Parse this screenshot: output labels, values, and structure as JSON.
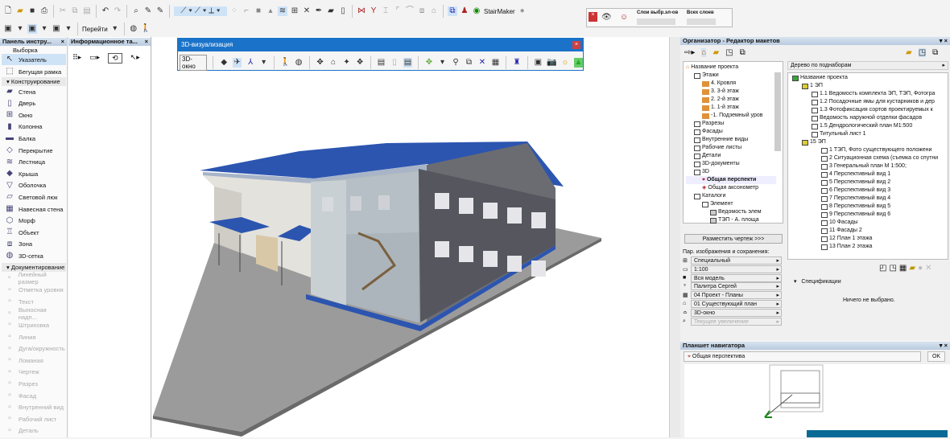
{
  "toolbar": {
    "goto_label": "Перейти",
    "stairmaker_label": "StairMaker",
    "layers_selected_label": "Слои выбр.эл-ов",
    "all_layers_label": "Всех слоев"
  },
  "toolbox": {
    "title": "Панель инстру...",
    "selection_label": "Выборка",
    "items_top": [
      {
        "label": "Указатель",
        "icon": "arrow-icon"
      },
      {
        "label": "Бегущая рамка",
        "icon": "marquee-icon"
      }
    ],
    "group_design": "Конструирование",
    "design_items": [
      "Стена",
      "Дверь",
      "Окно",
      "Колонна",
      "Балка",
      "Перекрытие",
      "Лестница",
      "Крыша",
      "Оболочка",
      "Световой люк",
      "Навесная стена",
      "Морф",
      "Объект",
      "Зона",
      "3D-сетка"
    ],
    "group_doc": "Документирование",
    "doc_items": [
      "Линейный размер",
      "Отметка уровня",
      "Текст",
      "Выносная надп...",
      "Штриховка",
      "Линия",
      "Дуга/окружность",
      "Ломаная",
      "Чертеж",
      "Разрез",
      "Фасад",
      "Внутренний вид",
      "Рабочий лист",
      "Деталь"
    ]
  },
  "info_box": {
    "title": "Информационное та..."
  },
  "viz3d": {
    "title": "3D-визуализация",
    "window_button": "3D-окно"
  },
  "organizer": {
    "title": "Организатор - Редактор макетов",
    "left_tree": [
      {
        "t": "Название проекта",
        "l": 0,
        "i": "project"
      },
      {
        "t": "Этажи",
        "l": 1,
        "i": "folder"
      },
      {
        "t": "4. Кровля",
        "l": 2,
        "i": "story"
      },
      {
        "t": "3. 3-й этаж",
        "l": 2,
        "i": "story"
      },
      {
        "t": "2. 2-й этаж",
        "l": 2,
        "i": "story"
      },
      {
        "t": "1. 1-й этаж",
        "l": 2,
        "i": "story"
      },
      {
        "t": "-1. Подземный уров",
        "l": 2,
        "i": "story"
      },
      {
        "t": "Разрезы",
        "l": 1,
        "i": "view"
      },
      {
        "t": "Фасады",
        "l": 1,
        "i": "view"
      },
      {
        "t": "Внутренние виды",
        "l": 1,
        "i": "view"
      },
      {
        "t": "Рабочие листы",
        "l": 1,
        "i": "view"
      },
      {
        "t": "Детали",
        "l": 1,
        "i": "view"
      },
      {
        "t": "3D-документы",
        "l": 1,
        "i": "view"
      },
      {
        "t": "3D",
        "l": 1,
        "i": "view"
      },
      {
        "t": "Общая перспекти",
        "l": 2,
        "i": "camera",
        "bold": true
      },
      {
        "t": "Общая аксонометр",
        "l": 2,
        "i": "axo"
      },
      {
        "t": "Каталоги",
        "l": 1,
        "i": "view"
      },
      {
        "t": "Элемент",
        "l": 2,
        "i": "view"
      },
      {
        "t": "Ведомость элем",
        "l": 3,
        "i": "list"
      },
      {
        "t": "ТЭП - А. площа",
        "l": 3,
        "i": "list"
      }
    ],
    "place_button": "Разместить чертеж >>>",
    "params_label": "Пар. изображения и сохранения:",
    "params": [
      "Специальный",
      "1:100",
      "Вся модель",
      "Палитра Сергей",
      "04 Проект - Планы",
      "01 Существующий план",
      "3D-окно",
      "Текущее увеличение"
    ],
    "right_dropdown": "Дерево по поднаборам",
    "right_tree": [
      {
        "t": "Название проекта",
        "l": 0
      },
      {
        "t": "1 ЭП",
        "l": 1
      },
      {
        "t": "1.1 Ведомость комплекта ЭП,  ТЭП, Фотогра",
        "l": 2
      },
      {
        "t": "1.2 Посадочные ямы для кустарников и дер",
        "l": 2
      },
      {
        "t": "1.3 Фотофиксация сортов проектируемых к",
        "l": 2
      },
      {
        "t": "Ведомость наружной отделки фасадов",
        "l": 2
      },
      {
        "t": "1.5 Дендрологический план М1:500",
        "l": 2
      },
      {
        "t": "Титульный лист 1",
        "l": 2
      },
      {
        "t": "15 ЭП",
        "l": 1
      },
      {
        "t": "1 ТЭП, Фото существующего положени",
        "l": 3
      },
      {
        "t": "2 Ситуационная схема (съемка со спутни",
        "l": 3
      },
      {
        "t": "3 Генеральный план М 1:500;",
        "l": 3
      },
      {
        "t": "4 Перспективный вид 1",
        "l": 3
      },
      {
        "t": "5 Перспективный вид 2",
        "l": 3
      },
      {
        "t": "6 Перспективный вид 3",
        "l": 3
      },
      {
        "t": "7 Перспективный вид 4",
        "l": 3
      },
      {
        "t": "8 Перспективный вид 5",
        "l": 3
      },
      {
        "t": "9 Перспективный вид 6",
        "l": 3
      },
      {
        "t": "10 Фасады",
        "l": 3
      },
      {
        "t": "11 Фасады 2",
        "l": 3
      },
      {
        "t": "12 План 1 этажа",
        "l": 3
      },
      {
        "t": "13 План 2 этажа",
        "l": 3
      }
    ],
    "specs_label": "Спецификации",
    "nothing_selected": "Ничего не выбрано."
  },
  "navigator": {
    "title": "Планшет навигатора",
    "view_name": "Общая перспектива",
    "ok_button": "OK"
  },
  "colors": {
    "accent": "#1a73c9",
    "roof": "#2c55b0",
    "facade": "#55565e",
    "ground": "#9a9a9a"
  }
}
